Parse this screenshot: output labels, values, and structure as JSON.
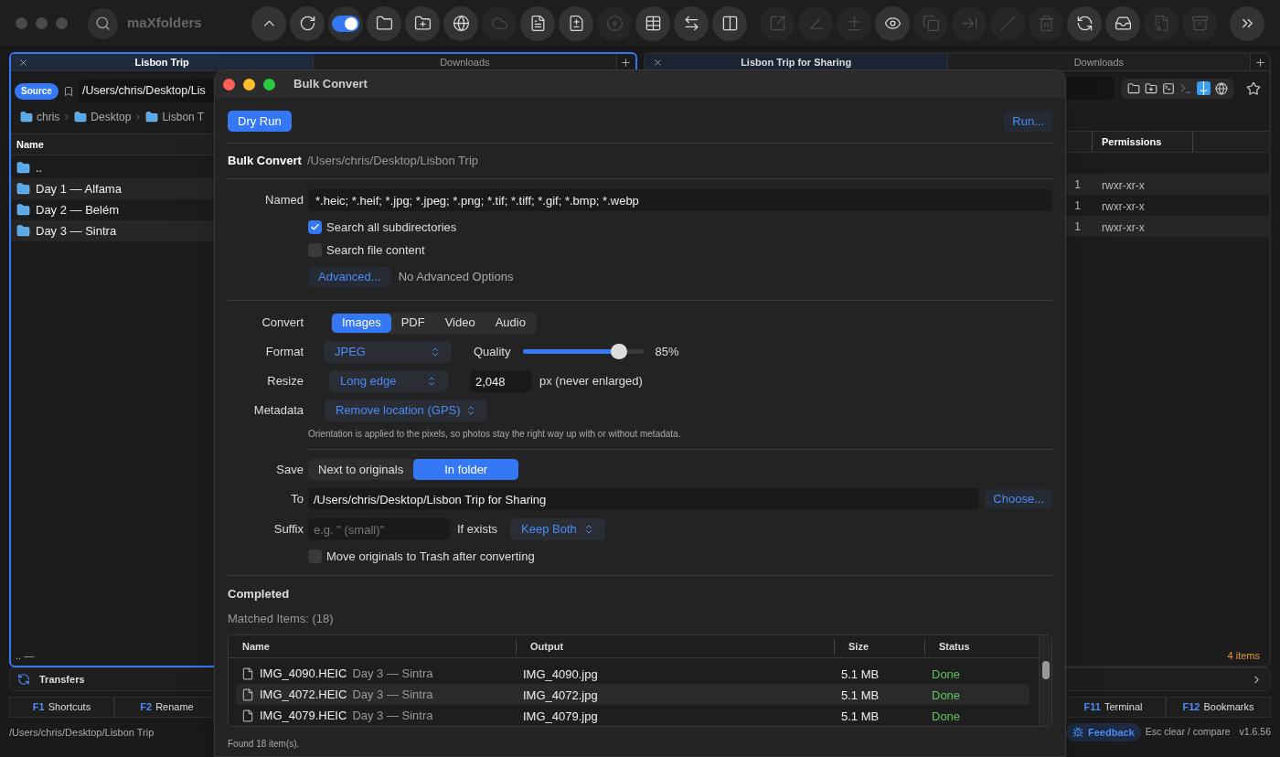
{
  "app": {
    "title": "maXfolders"
  },
  "toolbar": {
    "groups": [
      [
        {
          "kind": "button",
          "disabled": false
        },
        {
          "kind": "button",
          "disabled": false
        },
        {
          "kind": "toggle",
          "on": true
        },
        {
          "kind": "button",
          "disabled": false
        },
        {
          "kind": "button",
          "disabled": false
        },
        {
          "kind": "button",
          "disabled": false
        },
        {
          "kind": "button",
          "disabled": true
        },
        {
          "kind": "button",
          "disabled": false
        },
        {
          "kind": "button",
          "disabled": false
        },
        {
          "kind": "button",
          "disabled": true
        },
        {
          "kind": "button",
          "disabled": false
        },
        {
          "kind": "button",
          "disabled": false
        },
        {
          "kind": "button",
          "disabled": false
        }
      ],
      [
        {
          "kind": "button",
          "disabled": true
        },
        {
          "kind": "button",
          "disabled": true
        },
        {
          "kind": "button",
          "disabled": true
        },
        {
          "kind": "button",
          "disabled": false
        },
        {
          "kind": "button",
          "disabled": true
        },
        {
          "kind": "button",
          "disabled": true
        },
        {
          "kind": "button",
          "disabled": true
        },
        {
          "kind": "button",
          "disabled": true
        },
        {
          "kind": "button",
          "disabled": false
        },
        {
          "kind": "button",
          "disabled": false
        },
        {
          "kind": "button",
          "disabled": true
        },
        {
          "kind": "button",
          "disabled": true
        }
      ],
      [
        {
          "kind": "button",
          "disabled": false
        }
      ]
    ]
  },
  "left_panel": {
    "active": true,
    "tabs": [
      {
        "label": "Lisbon Trip",
        "selected": true
      },
      {
        "label": "Downloads",
        "selected": false
      }
    ],
    "source_badge": "Source",
    "path": "/Users/chris/Desktop/Lis",
    "breadcrumb": [
      "chris",
      "Desktop",
      "Lisbon T"
    ],
    "columns": [
      "Name"
    ],
    "rows": [
      {
        "name": ".."
      },
      {
        "name": "Day 1 — Alfama"
      },
      {
        "name": "Day 2 — Belém"
      },
      {
        "name": "Day 3 — Sintra"
      }
    ],
    "footer": ".. —"
  },
  "right_panel": {
    "active": false,
    "tabs": [
      {
        "label": "Lisbon Trip for Sharing",
        "selected": true
      },
      {
        "label": "Downloads",
        "selected": false
      }
    ],
    "columns": [
      "Permissions"
    ],
    "rows": [
      {
        "column_1": "1",
        "permissions": "rwxr-xr-x"
      },
      {
        "column_1": "1",
        "permissions": "rwxr-xr-x"
      },
      {
        "column_1": "1",
        "permissions": "rwxr-xr-x"
      }
    ],
    "footer": "4 items"
  },
  "transfers": {
    "label": "Transfers"
  },
  "function_keys": [
    {
      "key": "F1",
      "label": "Shortcuts"
    },
    {
      "key": "F2",
      "label": "Rename"
    },
    {
      "key": "F11",
      "label": "Terminal"
    },
    {
      "key": "F12",
      "label": "Bookmarks"
    }
  ],
  "status_bar": {
    "path": "/Users/chris/Desktop/Lisbon Trip",
    "feedback": "Feedback",
    "hint": "Esc clear / compare",
    "version": "v1.6.56"
  },
  "dialog": {
    "title": "Bulk Convert",
    "primary_button": "Dry Run",
    "secondary_button": "Run...",
    "heading": "Bulk Convert",
    "path": "/Users/chris/Desktop/Lisbon Trip",
    "named": {
      "label": "Named",
      "value": "*.heic; *.heif; *.jpg; *.jpeg; *.png; *.tif; *.tiff; *.gif; *.bmp; *.webp"
    },
    "options": [
      {
        "label": "Search all subdirectories",
        "checked": true
      },
      {
        "label": "Search file content",
        "checked": false
      }
    ],
    "advanced_button": "Advanced...",
    "advanced_status": "No Advanced Options",
    "convert": {
      "label": "Convert",
      "tabs": [
        {
          "label": "Images",
          "selected": true
        },
        {
          "label": "PDF",
          "selected": false
        },
        {
          "label": "Video",
          "selected": false
        },
        {
          "label": "Audio",
          "selected": false
        }
      ]
    },
    "format": {
      "label": "Format",
      "value": "JPEG"
    },
    "quality": {
      "label": "Quality",
      "level": 0.79,
      "reading": "85%"
    },
    "resize": {
      "label": "Resize",
      "value": "Long edge",
      "size": "2,048",
      "unit": "px (never enlarged)"
    },
    "metadata": {
      "label": "Metadata",
      "value": "Remove location (GPS)",
      "note": "Orientation is applied to the pixels, so photos stay the right way up with or without metadata."
    },
    "save": {
      "label": "Save",
      "options": [
        {
          "label": "Next to originals",
          "selected": false
        },
        {
          "label": "In folder",
          "selected": true
        }
      ]
    },
    "to": {
      "label": "To",
      "value": "/Users/chris/Desktop/Lisbon Trip for Sharing",
      "button": "Choose..."
    },
    "suffix": {
      "label": "Suffix",
      "placeholder": "e.g. \" (small)\"",
      "if_exists_label": "If exists",
      "if_exists_value": "Keep Both"
    },
    "trash_option": {
      "label": "Move originals to Trash after converting",
      "checked": false
    },
    "status": "Completed",
    "matched": "Matched Items: (18)",
    "results": {
      "columns": [
        "Name",
        "Output",
        "Size",
        "Status"
      ],
      "rows": [
        {
          "name": "IMG_4090.HEIC",
          "folder": "Day 3 — Sintra",
          "output": "IMG_4090.jpg",
          "size": "5.1 MB",
          "status": "Done"
        },
        {
          "name": "IMG_4072.HEIC",
          "folder": "Day 3 — Sintra",
          "output": "IMG_4072.jpg",
          "size": "5.1 MB",
          "status": "Done"
        },
        {
          "name": "IMG_4079.HEIC",
          "folder": "Day 3 — Sintra",
          "output": "IMG_4079.jpg",
          "size": "5.1 MB",
          "status": "Done"
        }
      ]
    },
    "footer": "Found 18 item(s)."
  }
}
